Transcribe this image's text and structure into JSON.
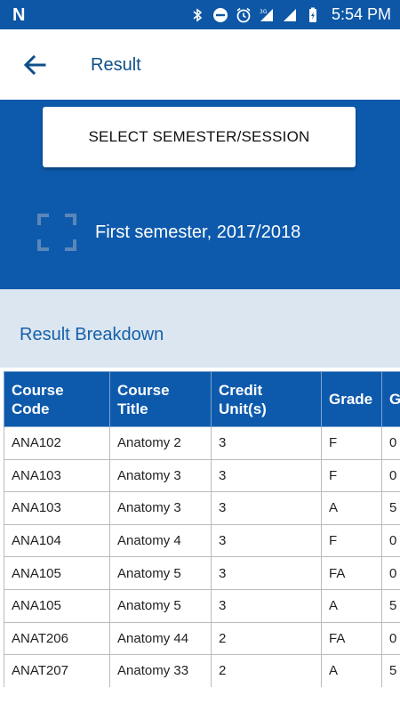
{
  "status_bar": {
    "logo": "N",
    "time": "5:54 PM",
    "network": "3G"
  },
  "app_bar": {
    "title": "Result",
    "back_icon": "arrow-back-icon"
  },
  "hero": {
    "select_button_label": "SELECT SEMESTER/SESSION",
    "semester_label": "First semester, 2017/2018",
    "scan_icon": "scan-frame-icon"
  },
  "breakdown": {
    "title": "Result Breakdown"
  },
  "table": {
    "headers": [
      "Course Code",
      "Course Title",
      "Credit Unit(s)",
      "Grade",
      "G"
    ],
    "rows": [
      [
        "ANA102",
        "Anatomy 2",
        "3",
        "F",
        "0"
      ],
      [
        "ANA103",
        "Anatomy 3",
        "3",
        "F",
        "0"
      ],
      [
        "ANA103",
        "Anatomy 3",
        "3",
        "A",
        "5"
      ],
      [
        "ANA104",
        "Anatomy 4",
        "3",
        "F",
        "0"
      ],
      [
        "ANA105",
        "Anatomy 5",
        "3",
        "FA",
        "0"
      ],
      [
        "ANA105",
        "Anatomy 5",
        "3",
        "A",
        "5"
      ],
      [
        "ANAT206",
        "Anatomy 44",
        "2",
        "FA",
        "0"
      ],
      [
        "ANAT207",
        "Anatomy 33",
        "2",
        "A",
        "5"
      ]
    ]
  },
  "colors": {
    "primary": "#0d5aad",
    "status_bar": "#0d57a6",
    "band": "#dce6f1",
    "title_text": "#1560a8"
  }
}
